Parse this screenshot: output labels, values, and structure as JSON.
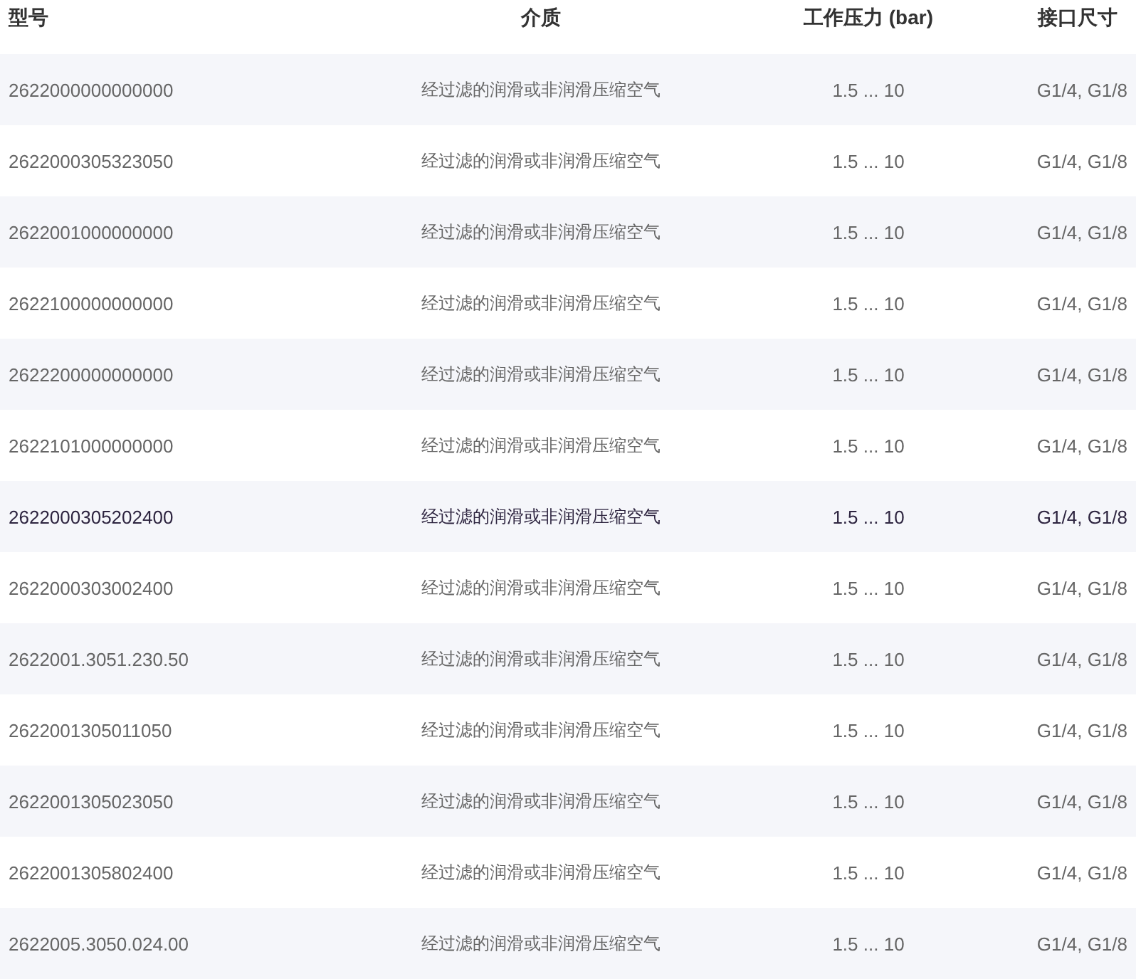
{
  "table": {
    "columns": [
      "型号",
      "介质",
      "工作压力 (bar)",
      "接口尺寸"
    ],
    "rows": [
      {
        "cells": [
          "2622000000000000",
          "经过滤的润滑或非润滑压缩空气",
          "1.5 ... 10",
          "G1/4, G1/8"
        ],
        "hovered": false
      },
      {
        "cells": [
          "2622000305323050",
          "经过滤的润滑或非润滑压缩空气",
          "1.5 ... 10",
          "G1/4, G1/8"
        ],
        "hovered": false
      },
      {
        "cells": [
          "2622001000000000",
          "经过滤的润滑或非润滑压缩空气",
          "1.5 ... 10",
          "G1/4, G1/8"
        ],
        "hovered": false
      },
      {
        "cells": [
          "2622100000000000",
          "经过滤的润滑或非润滑压缩空气",
          "1.5 ... 10",
          "G1/4, G1/8"
        ],
        "hovered": false
      },
      {
        "cells": [
          "2622200000000000",
          "经过滤的润滑或非润滑压缩空气",
          "1.5 ... 10",
          "G1/4, G1/8"
        ],
        "hovered": false
      },
      {
        "cells": [
          "2622101000000000",
          "经过滤的润滑或非润滑压缩空气",
          "1.5 ... 10",
          "G1/4, G1/8"
        ],
        "hovered": false
      },
      {
        "cells": [
          "2622000305202400",
          "经过滤的润滑或非润滑压缩空气",
          "1.5 ... 10",
          "G1/4, G1/8"
        ],
        "hovered": true
      },
      {
        "cells": [
          "2622000303002400",
          "经过滤的润滑或非润滑压缩空气",
          "1.5 ... 10",
          "G1/4, G1/8"
        ],
        "hovered": false
      },
      {
        "cells": [
          "2622001.3051.230.50",
          "经过滤的润滑或非润滑压缩空气",
          "1.5 ... 10",
          "G1/4, G1/8"
        ],
        "hovered": false
      },
      {
        "cells": [
          "2622001305011050",
          "经过滤的润滑或非润滑压缩空气",
          "1.5 ... 10",
          "G1/4, G1/8"
        ],
        "hovered": false
      },
      {
        "cells": [
          "2622001305023050",
          "经过滤的润滑或非润滑压缩空气",
          "1.5 ... 10",
          "G1/4, G1/8"
        ],
        "hovered": false
      },
      {
        "cells": [
          "2622001305802400",
          "经过滤的润滑或非润滑压缩空气",
          "1.5 ... 10",
          "G1/4, G1/8"
        ],
        "hovered": false
      },
      {
        "cells": [
          "2622005.3050.024.00",
          "经过滤的润滑或非润滑压缩空气",
          "1.5 ... 10",
          "G1/4, G1/8"
        ],
        "hovered": false
      }
    ]
  }
}
